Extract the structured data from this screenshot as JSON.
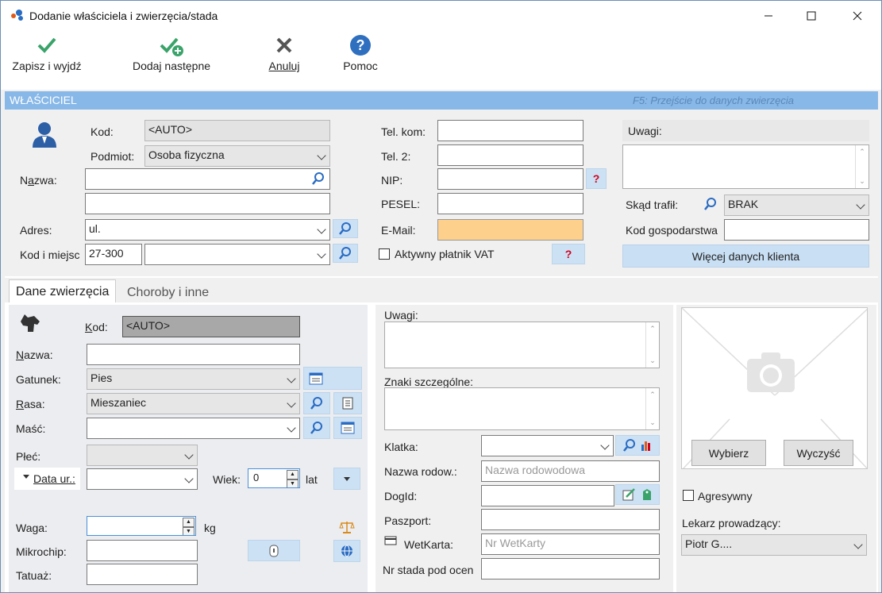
{
  "window": {
    "title": "Dodanie właściciela i zwierzęcia/stada"
  },
  "toolbar": {
    "save_exit": "Zapisz i wyjdź",
    "add_next": "Dodaj następne",
    "cancel": "Anuluj",
    "help": "Pomoc"
  },
  "owner": {
    "section_title": "WŁAŚCICIEL",
    "section_hint": "F5: Przejście do danych zwierzęcia",
    "kod_label": "Kod:",
    "kod_value": "<AUTO>",
    "podmiot_label": "Podmiot:",
    "podmiot_value": "Osoba fizyczna",
    "nazwa_label": "Nazwa:",
    "nazwa_value": "",
    "nazwa2_value": "",
    "adres_label": "Adres:",
    "adres_value": "ul.",
    "kod_miejsc_label": "Kod i miejsc",
    "postal_value": "27-300",
    "city_value": "",
    "tel_kom_label": "Tel. kom:",
    "tel2_label": "Tel. 2:",
    "nip_label": "NIP:",
    "pesel_label": "PESEL:",
    "email_label": "E-Mail:",
    "vat_label": "Aktywny płatnik VAT",
    "uwagi_label": "Uwagi:",
    "skad_label": "Skąd trafił:",
    "skad_value": "BRAK",
    "kod_gosp_label": "Kod gospodarstwa",
    "more_button": "Więcej danych klienta",
    "q_mark": "?"
  },
  "tabs": {
    "animal": "Dane zwierzęcia",
    "diseases": "Choroby i inne"
  },
  "animal": {
    "kod_label": "Kod:",
    "kod_value": "<AUTO>",
    "nazwa_label": "Nazwa:",
    "gatunek_label": "Gatunek:",
    "gatunek_value": "Pies",
    "rasa_label": "Rasa:",
    "rasa_value": "Mieszaniec",
    "masc_label": "Maść:",
    "plec_label": "Płeć:",
    "data_ur_label": "Data ur.:",
    "wiek_label": "Wiek:",
    "wiek_value": "0",
    "lat_label": "lat",
    "waga_label": "Waga:",
    "kg_label": "kg",
    "mikrochip_label": "Mikrochip:",
    "tatuaz_label": "Tatuaż:",
    "uwagi_label": "Uwagi:",
    "znaki_label": "Znaki szczególne:",
    "klatka_label": "Klatka:",
    "nazwa_rodow_label": "Nazwa rodow.:",
    "nazwa_rodow_placeholder": "Nazwa rodowodowa",
    "dogid_label": "DogId:",
    "paszport_label": "Paszport:",
    "wetkarta_label": "WetKarta:",
    "wetkarta_placeholder": "Nr WetKarty",
    "nr_stada_label": "Nr stada pod ocen",
    "wybierz_button": "Wybierz",
    "wyczysc_button": "Wyczyść",
    "agresywny_label": "Agresywny",
    "lekarz_label": "Lekarz prowadzący:",
    "lekarz_value": "Piotr G...."
  }
}
